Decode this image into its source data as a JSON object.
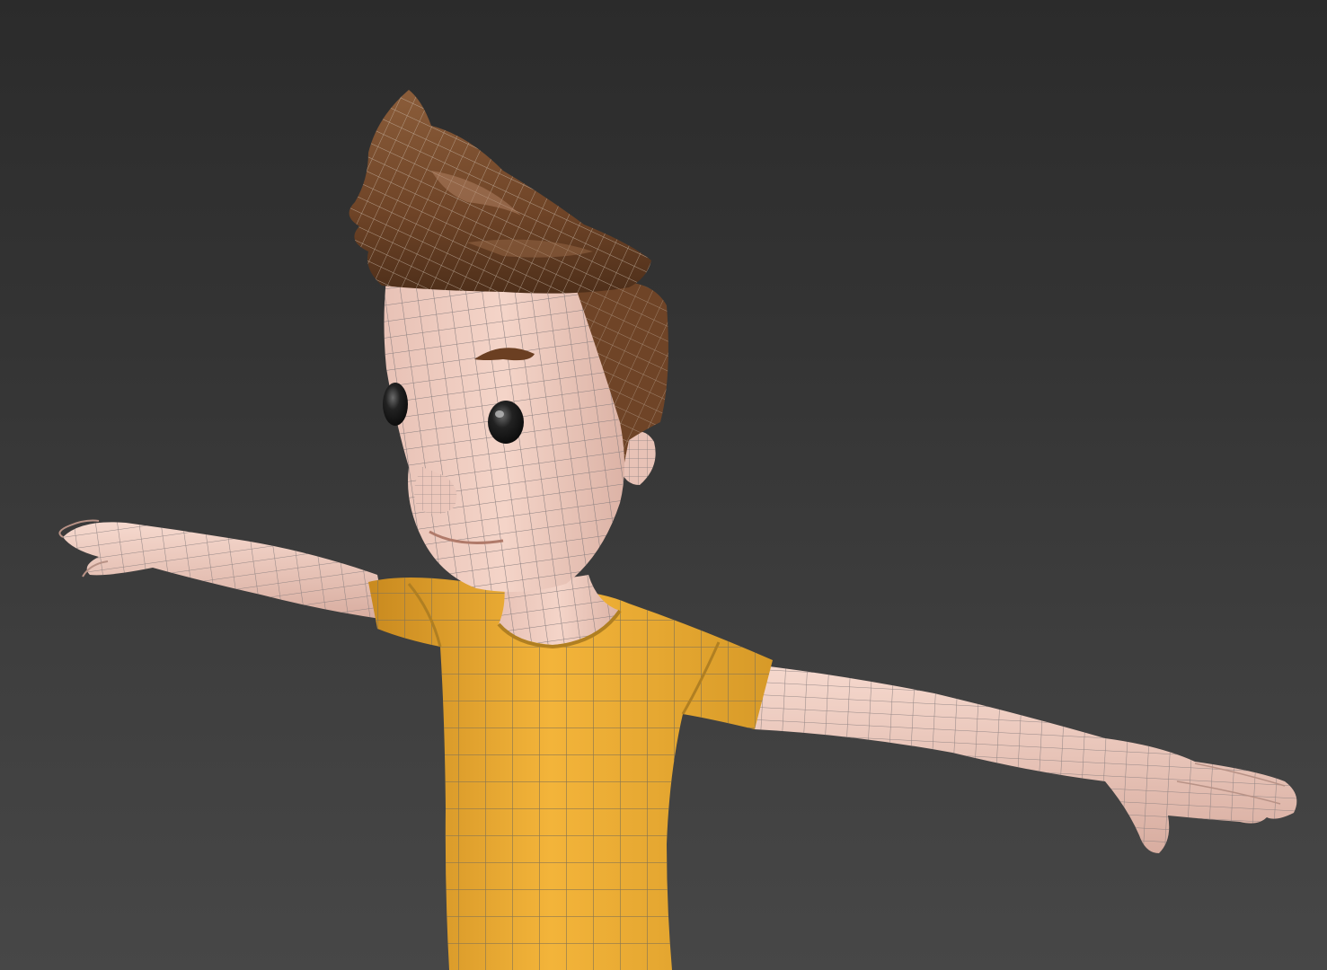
{
  "viewport": {
    "mode": "shaded-with-wireframe",
    "background_top": "#2b2b2b",
    "background_bottom": "#474747"
  },
  "model": {
    "pose": "T-pose",
    "colors": {
      "skin": "#f2cfc3",
      "skin_shadow": "#d9aea2",
      "shirt": "#f0b030",
      "shirt_shadow": "#c98a1f",
      "hair": "#7a4f30",
      "hair_light": "#b08060",
      "hair_dark": "#4e2f1a",
      "eye": "#1a1a1a",
      "wire": "#8a8a8a"
    }
  }
}
